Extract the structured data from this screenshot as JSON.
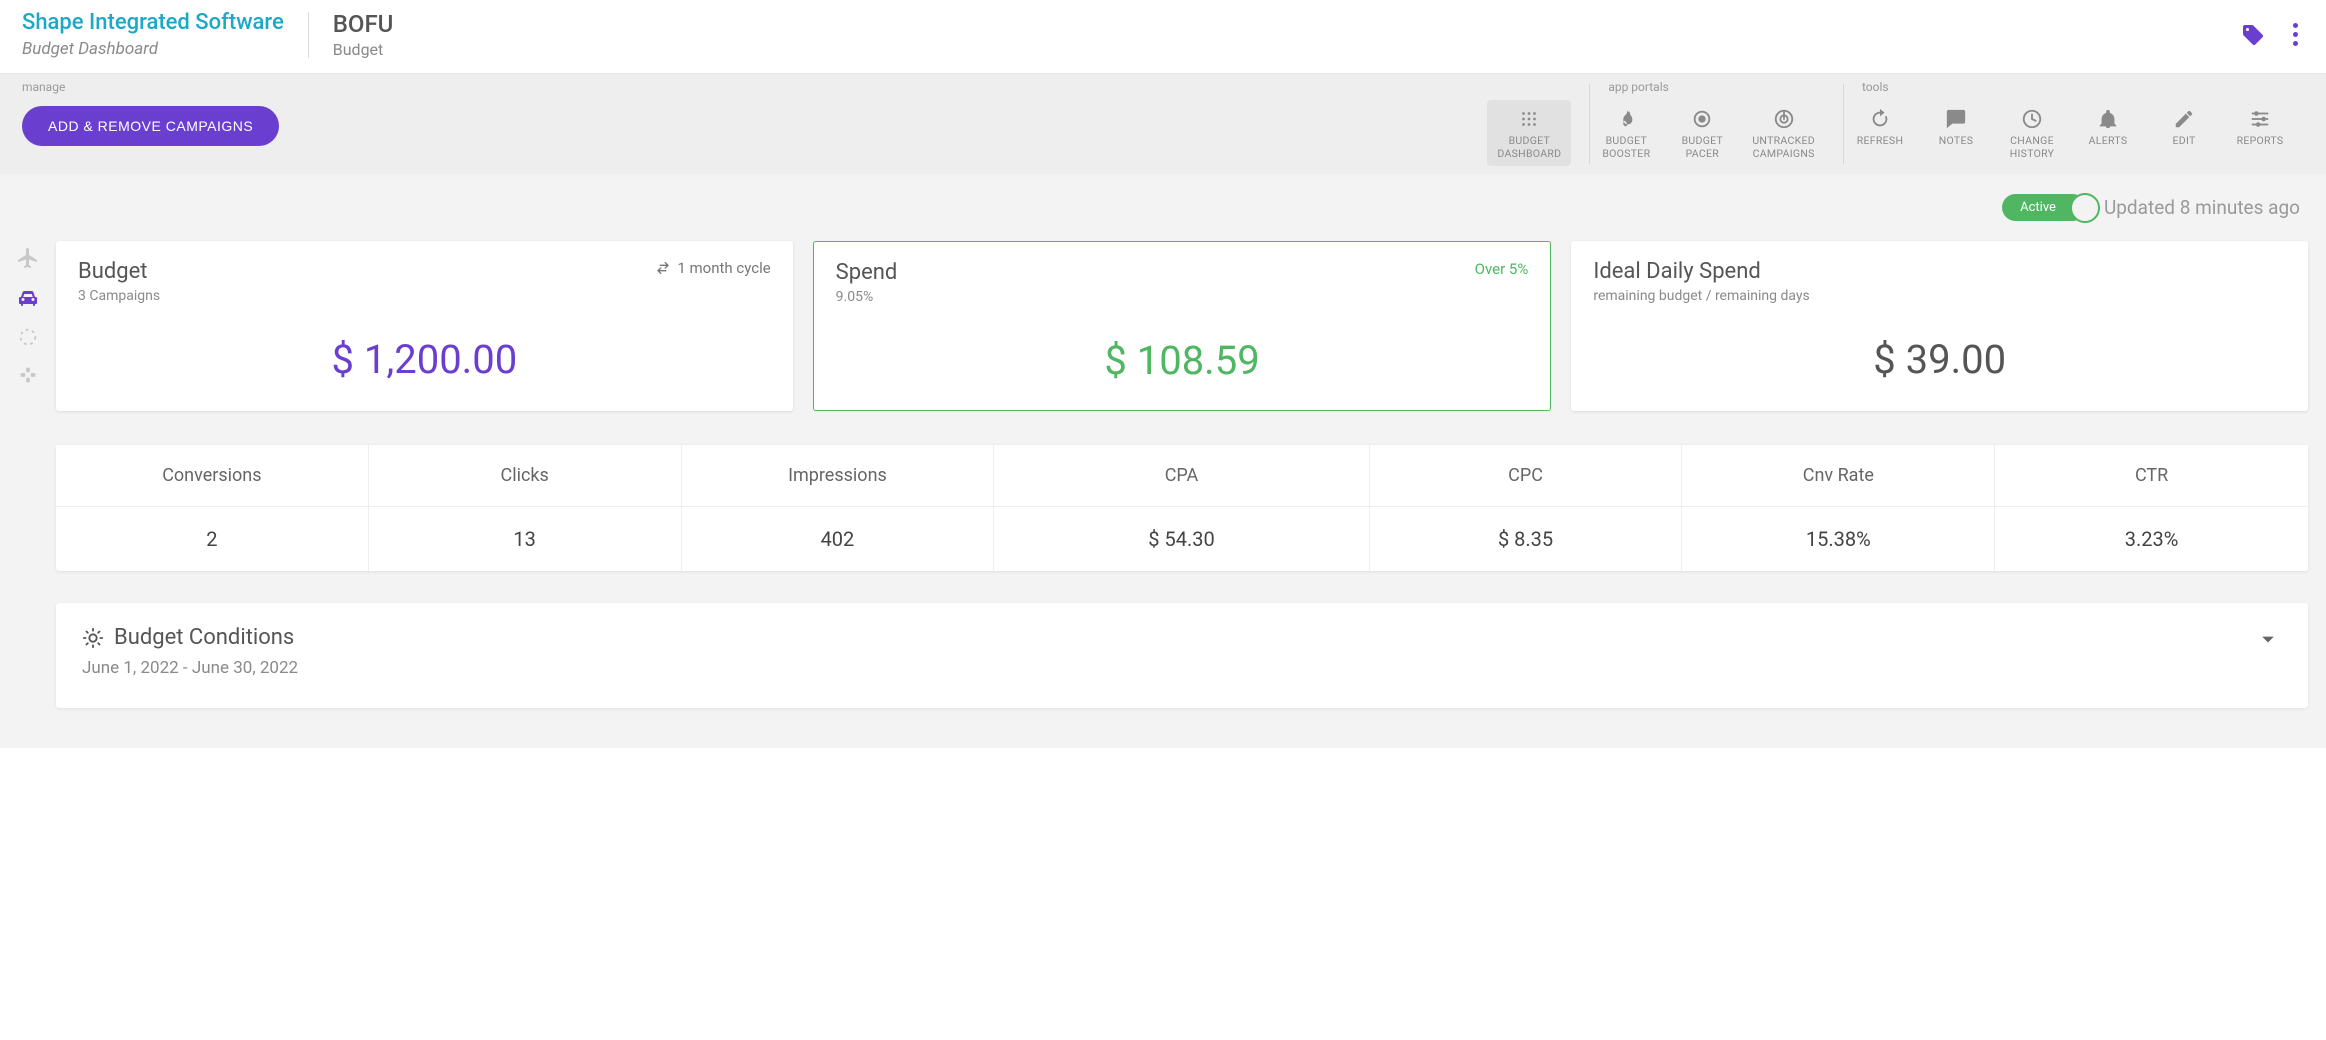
{
  "brand": {
    "title": "Shape Integrated Software",
    "subtitle": "Budget Dashboard"
  },
  "page": {
    "title": "BOFU",
    "subtitle": "Budget"
  },
  "toolbar": {
    "manage_label": "manage",
    "add_remove_label": "ADD & REMOVE CAMPAIGNS",
    "budget_dashboard": "BUDGET\nDASHBOARD",
    "app_portals_label": "app portals",
    "budget_booster": "BUDGET\nBOOSTER",
    "budget_pacer": "BUDGET\nPACER",
    "untracked_campaigns": "UNTRACKED\nCAMPAIGNS",
    "tools_label": "tools",
    "refresh": "REFRESH",
    "notes": "NOTES",
    "change_history": "CHANGE\nHISTORY",
    "alerts": "ALERTS",
    "edit": "EDIT",
    "reports": "REPORTS"
  },
  "status": {
    "badge": "Active",
    "updated": "Updated 8 minutes ago"
  },
  "cards": {
    "budget": {
      "title": "Budget",
      "campaigns": "3 Campaigns",
      "cycle": "1 month cycle",
      "value": "$ 1,200.00"
    },
    "spend": {
      "title": "Spend",
      "percent": "9.05%",
      "status": "Over 5%",
      "value": "$ 108.59"
    },
    "ideal": {
      "title": "Ideal Daily Spend",
      "subtitle": "remaining budget / remaining days",
      "value": "$ 39.00"
    }
  },
  "metrics": {
    "headers": [
      "Conversions",
      "Clicks",
      "Impressions",
      "CPA",
      "CPC",
      "Cnv Rate",
      "CTR"
    ],
    "values": [
      "2",
      "13",
      "402",
      "$ 54.30",
      "$ 8.35",
      "15.38%",
      "3.23%"
    ]
  },
  "conditions": {
    "title": "Budget Conditions",
    "range": "June 1, 2022  -  June 30, 2022"
  }
}
